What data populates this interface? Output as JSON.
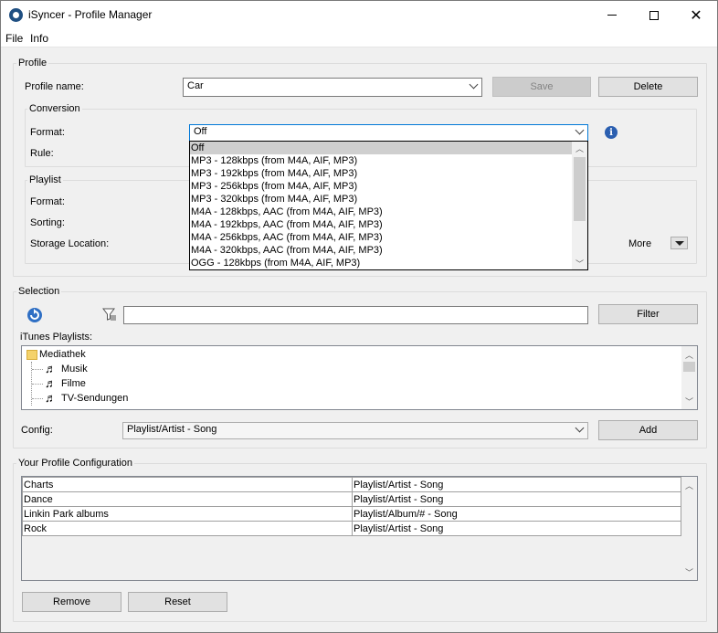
{
  "window": {
    "title": "iSyncer - Profile Manager",
    "controls": {
      "minimize": "—",
      "maximize": "☐",
      "close": "✕"
    }
  },
  "menu": [
    "File",
    "Info"
  ],
  "profile": {
    "group_label": "Profile",
    "name_label": "Profile name:",
    "name_value": "Car",
    "save_label": "Save",
    "delete_label": "Delete",
    "conversion": {
      "group_label": "Conversion",
      "format_label": "Format:",
      "format_value": "Off",
      "rule_label": "Rule:",
      "info_icon": "i",
      "options": [
        "Off",
        "MP3 - 128kbps (from M4A, AIF, MP3)",
        "MP3 - 192kbps (from M4A, AIF, MP3)",
        "MP3 - 256kbps (from M4A, AIF, MP3)",
        "MP3 - 320kbps (from M4A, AIF, MP3)",
        "M4A - 128kbps, AAC (from M4A, AIF, MP3)",
        "M4A - 192kbps, AAC (from M4A, AIF, MP3)",
        "M4A - 256kbps, AAC (from M4A, AIF, MP3)",
        "M4A - 320kbps, AAC (from M4A, AIF, MP3)",
        "OGG - 128kbps (from M4A, AIF, MP3)"
      ]
    },
    "playlist": {
      "group_label": "Playlist",
      "format_label": "Format:",
      "sorting_label": "Sorting:",
      "storage_label": "Storage Location:",
      "more_label": "More"
    }
  },
  "selection": {
    "group_label": "Selection",
    "filter_label": "Filter",
    "itunes_label": "iTunes Playlists:",
    "tree": [
      {
        "label": "Mediathek",
        "icon": "folder-icon"
      },
      {
        "label": "Musik",
        "icon": "playlist-icon"
      },
      {
        "label": "Filme",
        "icon": "playlist-icon"
      },
      {
        "label": "TV-Sendungen",
        "icon": "playlist-icon"
      }
    ],
    "config_label": "Config:",
    "config_value": "Playlist/Artist - Song",
    "add_label": "Add"
  },
  "your_config": {
    "group_label": "Your Profile Configuration",
    "rows": [
      [
        "Charts",
        "Playlist/Artist - Song"
      ],
      [
        "Dance",
        "Playlist/Artist - Song"
      ],
      [
        "Linkin Park albums",
        "Playlist/Album/# - Song"
      ],
      [
        "Rock",
        "Playlist/Artist - Song"
      ]
    ],
    "remove_label": "Remove",
    "reset_label": "Reset"
  }
}
